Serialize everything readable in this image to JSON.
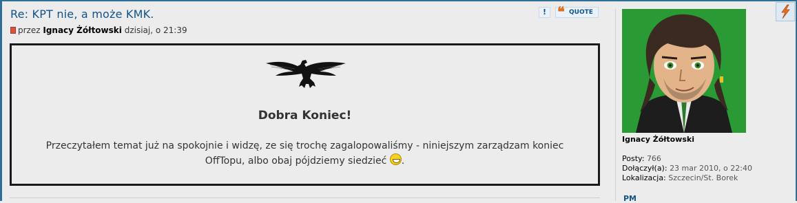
{
  "post": {
    "title": "Re: KPT nie, a może KMK.",
    "by_label": "przez",
    "author": "Ignacy Żółtowski",
    "time": "dzisiaj, o 21:39",
    "report_label": "!",
    "quote_label": "QUOTE",
    "quote_glyph": "❝"
  },
  "box": {
    "heading": "Dobra Koniec!",
    "body_line1": "Przeczytałem temat już na spokojnie i widzę, ze się trochę zagalopowaliśmy - niniejszym zarządzam koniec",
    "body_line2": "OffTopu, albo obaj pójdziemy siedzieć",
    "body_end": "."
  },
  "profile": {
    "name": "Ignacy Żółtowski",
    "posts_label": "Posty:",
    "posts": "766",
    "joined_label": "Dołączył(a):",
    "joined": "23 mar 2010, o 22:40",
    "location_label": "Lokalizacja:",
    "location": "Szczecin/St. Borek",
    "pm_label": "PM"
  },
  "colors": {
    "frame": "#2d6f98",
    "title": "#105289",
    "avatar_bg": "#2a9a35"
  },
  "icons": [
    "post-doc-icon",
    "report-icon",
    "quote-icon",
    "eagle-image",
    "grin-smiley-icon",
    "corner-icon"
  ]
}
